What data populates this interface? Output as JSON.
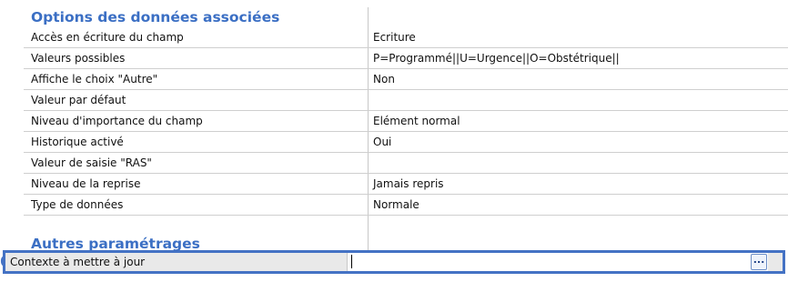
{
  "sections": {
    "options_title": "Options des données associées",
    "other_title": "Autres paramétrages"
  },
  "rows": [
    {
      "label": "Accès en écriture du champ",
      "value": "Ecriture"
    },
    {
      "label": "Valeurs possibles",
      "value": "P=Programmé||U=Urgence||O=Obstétrique||"
    },
    {
      "label": "Affiche le choix \"Autre\"",
      "value": "Non"
    },
    {
      "label": "Valeur par défaut",
      "value": ""
    },
    {
      "label": "Niveau d'importance du champ",
      "value": "Elément normal"
    },
    {
      "label": "Historique activé",
      "value": "Oui"
    },
    {
      "label": "Valeur de saisie \"RAS\"",
      "value": ""
    },
    {
      "label": "Niveau de la reprise",
      "value": "Jamais repris"
    },
    {
      "label": "Type de données",
      "value": "Normale"
    }
  ],
  "selected_row": {
    "label": "Contexte à mettre à jour",
    "value": "",
    "button_label": "..."
  },
  "side_letter": "e",
  "colors": {
    "accent": "#4472c4",
    "section_text": "#3b6fc4",
    "grid_line": "#cfcfcf"
  }
}
